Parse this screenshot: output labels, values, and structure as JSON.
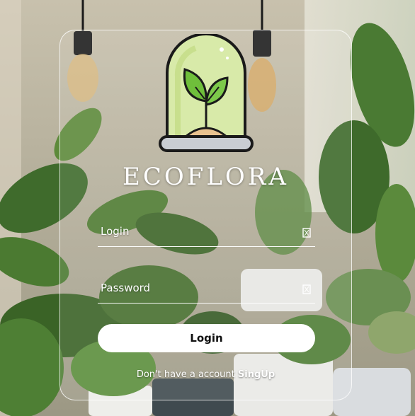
{
  "app": {
    "brand_name": "ECOFLORA"
  },
  "form": {
    "login_placeholder": "Login",
    "login_value": "",
    "password_placeholder": "Password",
    "password_value": "",
    "submit_label": "Login"
  },
  "signup": {
    "prompt": "Don't have a account",
    "link_label": "SingUp"
  },
  "icons": {
    "login_field_icon": "missing-glyph-box-icon",
    "password_field_icon": "missing-glyph-box-icon",
    "logo": "terrarium-sprout-logo"
  },
  "colors": {
    "card_border": "#ffffff",
    "button_bg": "#ffffff",
    "button_text": "#111111",
    "text": "#ffffff",
    "logo_dome": "#d8eaa9",
    "logo_leaf": "#6fbf3b",
    "logo_soil": "#e9c28f",
    "logo_base": "#c9cdd3"
  }
}
